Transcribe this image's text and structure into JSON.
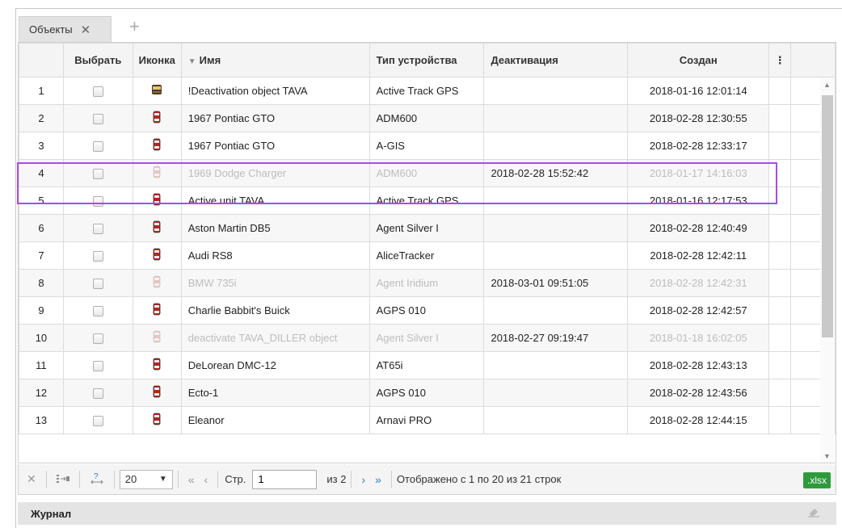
{
  "tabs": {
    "active_label": "Объекты",
    "close_glyph": "✕",
    "add_glyph": "+"
  },
  "table": {
    "headers": {
      "select": "Выбрать",
      "icon": "Иконка",
      "name": "Имя",
      "name_sort_glyph": "▼",
      "device_type": "Тип устройства",
      "deactivation": "Деактивация",
      "created": "Создан",
      "menu_glyph": "⋮"
    },
    "rows": [
      {
        "num": "1",
        "name": "!Deactivation object TAVA",
        "device": "Active Track GPS",
        "deact": "",
        "created": "2018-01-16 12:01:14",
        "inactive": false,
        "icon": "truck-icon"
      },
      {
        "num": "2",
        "name": "1967 Pontiac GTO",
        "device": "ADM600",
        "deact": "",
        "created": "2018-02-28 12:30:55",
        "inactive": false,
        "icon": "car-icon"
      },
      {
        "num": "3",
        "name": "1967 Pontiac GTO",
        "device": "A-GIS",
        "deact": "",
        "created": "2018-02-28 12:33:17",
        "inactive": false,
        "icon": "car-icon"
      },
      {
        "num": "4",
        "name": "1969 Dodge Charger",
        "device": "ADM600",
        "deact": "2018-02-28 15:52:42",
        "created": "2018-01-17 14:16:03",
        "inactive": true,
        "icon": "car-icon"
      },
      {
        "num": "5",
        "name": "Active unit TAVA",
        "device": "Active Track GPS",
        "deact": "",
        "created": "2018-01-16 12:17:53",
        "inactive": false,
        "icon": "car-icon"
      },
      {
        "num": "6",
        "name": "Aston Martin DB5",
        "device": "Agent Silver I",
        "deact": "",
        "created": "2018-02-28 12:40:49",
        "inactive": false,
        "icon": "car-icon"
      },
      {
        "num": "7",
        "name": "Audi RS8",
        "device": "AliceTracker",
        "deact": "",
        "created": "2018-02-28 12:42:11",
        "inactive": false,
        "icon": "car-icon"
      },
      {
        "num": "8",
        "name": "BMW 735i",
        "device": "Agent Iridium",
        "deact": "2018-03-01 09:51:05",
        "created": "2018-02-28 12:42:31",
        "inactive": true,
        "icon": "car-icon"
      },
      {
        "num": "9",
        "name": "Charlie Babbit's Buick",
        "device": "AGPS 010",
        "deact": "",
        "created": "2018-02-28 12:42:57",
        "inactive": false,
        "icon": "car-icon"
      },
      {
        "num": "10",
        "name": "deactivate TAVA_DILLER object",
        "device": "Agent Silver I",
        "deact": "2018-02-27 09:19:47",
        "created": "2018-01-18 16:02:05",
        "inactive": true,
        "icon": "car-icon"
      },
      {
        "num": "11",
        "name": "DeLorean DMC-12",
        "device": "AT65i",
        "deact": "",
        "created": "2018-02-28 12:43:13",
        "inactive": false,
        "icon": "car-icon"
      },
      {
        "num": "12",
        "name": "Ecto-1",
        "device": "AGPS 010",
        "deact": "",
        "created": "2018-02-28 12:43:56",
        "inactive": false,
        "icon": "car-icon"
      },
      {
        "num": "13",
        "name": "Eleanor",
        "device": "Arnavi PRO",
        "deact": "",
        "created": "2018-02-28 12:44:15",
        "inactive": false,
        "icon": "car-icon"
      }
    ]
  },
  "pager": {
    "clear_glyph": "✕",
    "page_size": "20",
    "page_label": "Стр.",
    "page_value": "1",
    "of_label": "из 2",
    "status": "Отображено с 1 по 20 из 21 строк",
    "export_label": ".xlsx"
  },
  "journal": {
    "title": "Журнал"
  },
  "colors": {
    "highlight": "#a64ee0",
    "export": "#2f9a3c",
    "active_nav": "#2a7fc1"
  }
}
